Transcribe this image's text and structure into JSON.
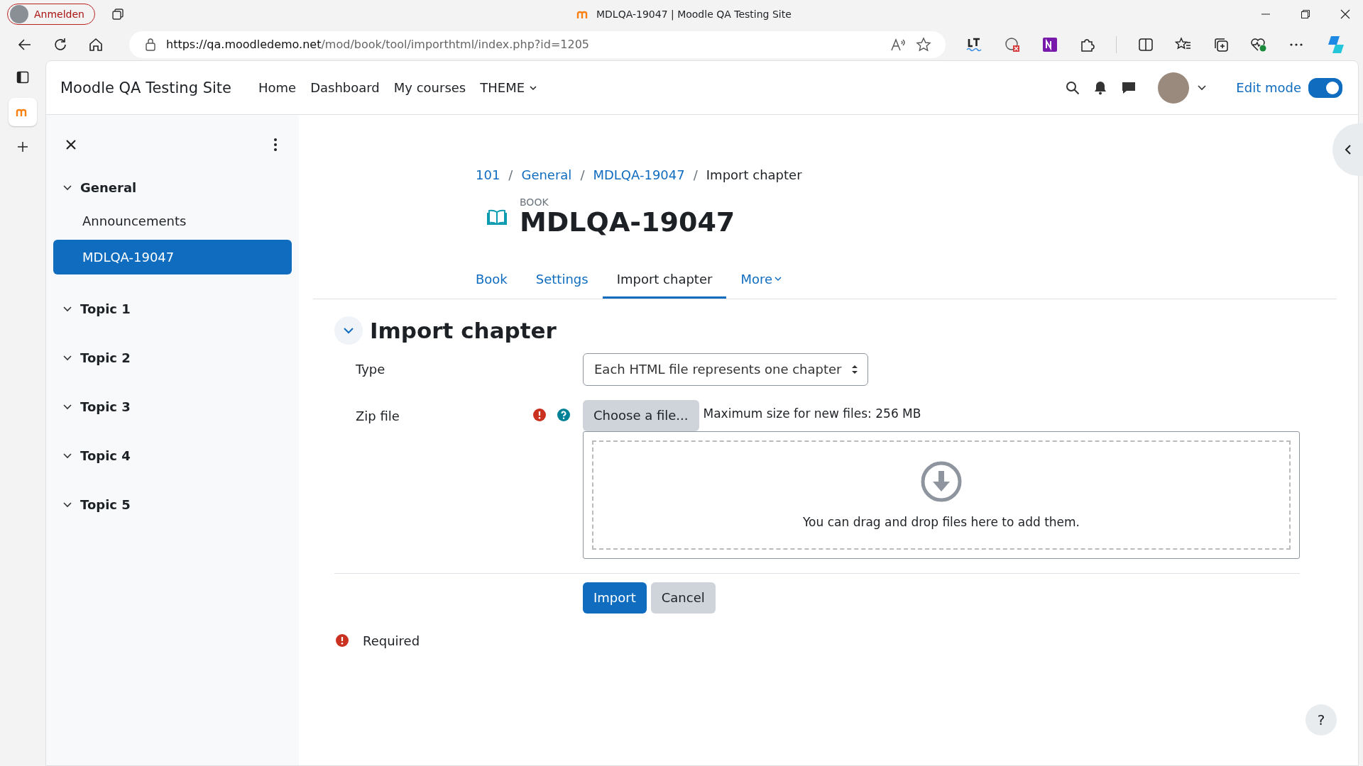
{
  "browser": {
    "profile_label": "Anmelden",
    "tab_title": "MDLQA-19047 | Moodle QA Testing Site",
    "url_host": "https://qa.moodledemo.net",
    "url_path": "/mod/book/tool/importhtml/index.php?id=1205"
  },
  "navbar": {
    "site_name": "Moodle QA Testing Site",
    "links": [
      {
        "label": "Home",
        "dropdown": false
      },
      {
        "label": "Dashboard",
        "dropdown": false
      },
      {
        "label": "My courses",
        "dropdown": false
      },
      {
        "label": "THEME",
        "dropdown": true
      }
    ],
    "edit_mode": {
      "label": "Edit mode",
      "on": true
    }
  },
  "drawer": {
    "sections": [
      {
        "label": "General",
        "expanded": true,
        "children": [
          {
            "label": "Announcements",
            "selected": false
          },
          {
            "label": "MDLQA-19047",
            "selected": true
          }
        ]
      },
      {
        "label": "Topic 1",
        "expanded": true
      },
      {
        "label": "Topic 2",
        "expanded": true
      },
      {
        "label": "Topic 3",
        "expanded": true
      },
      {
        "label": "Topic 4",
        "expanded": true
      },
      {
        "label": "Topic 5",
        "expanded": true
      }
    ]
  },
  "breadcrumb": [
    {
      "label": "101",
      "link": true
    },
    {
      "separator": "/",
      "label": "General",
      "link": true
    },
    {
      "separator": "/",
      "label": "MDLQA-19047",
      "link": true
    },
    {
      "separator": "/",
      "label": "Import chapter",
      "link": false
    }
  ],
  "header": {
    "kind_label": "BOOK",
    "title": "MDLQA-19047"
  },
  "tabs": [
    {
      "label": "Book",
      "selected": false,
      "dropdown": false
    },
    {
      "label": "Settings",
      "selected": false,
      "dropdown": false
    },
    {
      "label": "Import chapter",
      "selected": true,
      "dropdown": false
    },
    {
      "label": "More",
      "selected": false,
      "dropdown": true
    }
  ],
  "form": {
    "heading": "Import chapter",
    "expanded": true,
    "type_label": "Type",
    "type_value": "Each HTML file represents one chapter",
    "zip_label": "Zip file",
    "choose_button": "Choose a file...",
    "max_size": "Maximum size for new files: 256 MB",
    "drop_text": "You can drag and drop files here to add them.",
    "buttons": [
      {
        "label": "Import",
        "kind": "primary"
      },
      {
        "label": "Cancel",
        "kind": "secondary"
      }
    ],
    "required_note": "Required"
  },
  "help_button": "?"
}
